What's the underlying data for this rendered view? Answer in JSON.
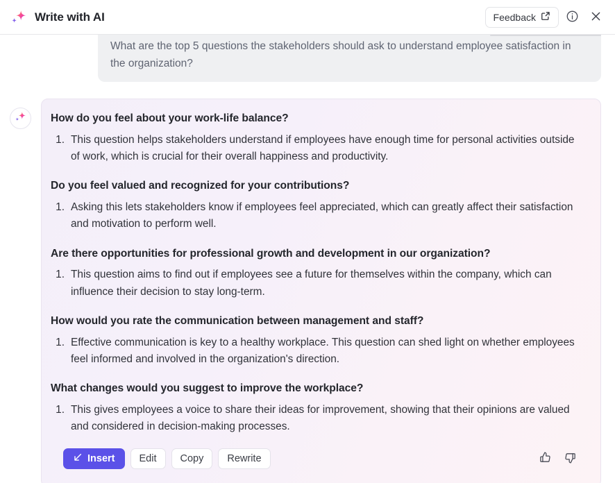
{
  "header": {
    "logo_icon": "sparkle-icon",
    "title": "Write with AI",
    "feedback_label": "Feedback",
    "feedback_icon": "external-link-icon",
    "info_icon": "info-circle-icon",
    "close_icon": "close-x-icon"
  },
  "conversation": {
    "user_prompt": "What are the top 5 questions the stakeholders should ask to understand employee satisfaction in the organization?",
    "assistant_avatar_icon": "sparkle-icon",
    "sections": [
      {
        "heading": "How do you feel about your work-life balance?",
        "number": "1.",
        "text": "This question helps stakeholders understand if employees have enough time for personal activities outside of work, which is crucial for their overall happiness and productivity."
      },
      {
        "heading": "Do you feel valued and recognized for your contributions?",
        "number": "1.",
        "text": "Asking this lets stakeholders know if employees feel appreciated, which can greatly affect their satisfaction and motivation to perform well."
      },
      {
        "heading": "Are there opportunities for professional growth and development in our organization?",
        "number": "1.",
        "text": "This question aims to find out if employees see a future for themselves within the company, which can influence their decision to stay long-term."
      },
      {
        "heading": "How would you rate the communication between management and staff?",
        "number": "1.",
        "text": "Effective communication is key to a healthy workplace. This question can shed light on whether employees feel informed and involved in the organization's direction."
      },
      {
        "heading": "What changes would you suggest to improve the workplace?",
        "number": "1.",
        "text": "This gives employees a voice to share their ideas for improvement, showing that their opinions are valued and considered in decision-making processes."
      }
    ]
  },
  "actions": {
    "insert_label": "Insert",
    "insert_icon": "arrow-down-left-icon",
    "edit_label": "Edit",
    "copy_label": "Copy",
    "rewrite_label": "Rewrite",
    "thumbs_up_icon": "thumbs-up-icon",
    "thumbs_down_icon": "thumbs-down-icon"
  },
  "colors": {
    "accent": "#5b51e8",
    "card_start": "#f4eff9",
    "card_end": "#fdf3f6",
    "prompt_bubble": "#eff0f2",
    "text": "#303239"
  }
}
